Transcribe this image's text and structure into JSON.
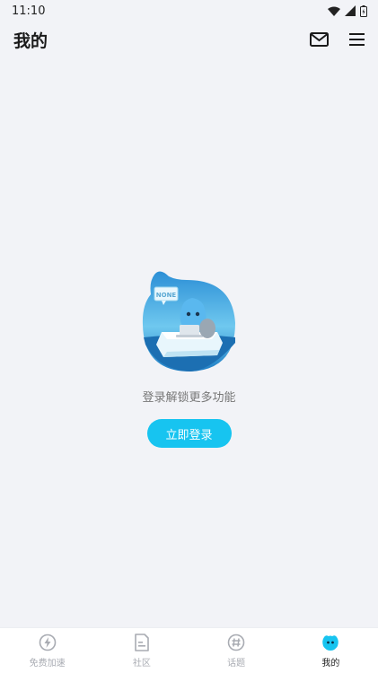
{
  "status_bar": {
    "time": "11:10"
  },
  "header": {
    "title": "我的",
    "mail_icon": "mail-icon",
    "menu_icon": "menu-icon"
  },
  "main": {
    "illustration": "mascot-on-iceberg-illustration",
    "illustration_sign": "NONE",
    "hint": "登录解锁更多功能",
    "login_button": "立即登录"
  },
  "bottom_nav": {
    "items": [
      {
        "label": "免费加速",
        "icon": "lightning-icon",
        "active": false
      },
      {
        "label": "社区",
        "icon": "document-icon",
        "active": false
      },
      {
        "label": "话题",
        "icon": "hashtag-icon",
        "active": false
      },
      {
        "label": "我的",
        "icon": "mascot-face-icon",
        "active": true
      }
    ]
  },
  "colors": {
    "accent": "#17c4f0",
    "background": "#f2f3f7",
    "inactive": "#a8abb2"
  }
}
